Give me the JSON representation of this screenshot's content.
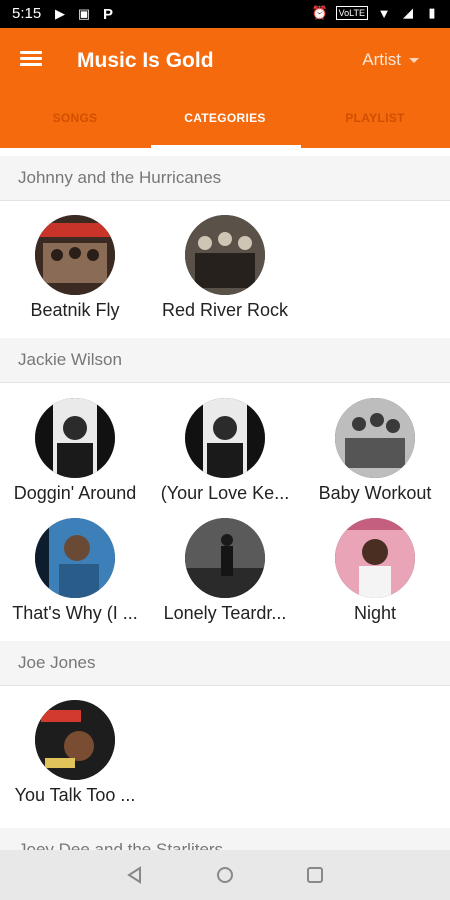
{
  "status_bar": {
    "time": "5:15",
    "volte": "VoLTE"
  },
  "app_bar": {
    "title": "Music Is Gold",
    "artist_select": "Artist"
  },
  "tabs": [
    {
      "label": "SONGS"
    },
    {
      "label": "CATEGORIES"
    },
    {
      "label": "PLAYLIST"
    }
  ],
  "sections": [
    {
      "name": "Johnny and the Hurricanes",
      "items": [
        {
          "title": "Beatnik Fly",
          "art": "album-cover"
        },
        {
          "title": "Red River Rock",
          "art": "band-photo"
        }
      ]
    },
    {
      "name": "Jackie Wilson",
      "items": [
        {
          "title": "Doggin' Around",
          "art": "portrait"
        },
        {
          "title": "(Your Love Ke...",
          "art": "portrait"
        },
        {
          "title": "Baby Workout",
          "art": "group-photo"
        },
        {
          "title": "That's Why (I ...",
          "art": "portrait-blue"
        },
        {
          "title": "Lonely Teardr...",
          "art": "stage-photo"
        },
        {
          "title": "Night",
          "art": "pink-cover"
        }
      ]
    },
    {
      "name": "Joe Jones",
      "items": [
        {
          "title": "You Talk Too ...",
          "art": "album-cover"
        }
      ]
    },
    {
      "name": "Joey Dee and the Starliters",
      "items": []
    }
  ],
  "colors": {
    "primary": "#f46a0c",
    "tab_inactive": "#d24f00",
    "section_bg": "#f5f5f5"
  }
}
